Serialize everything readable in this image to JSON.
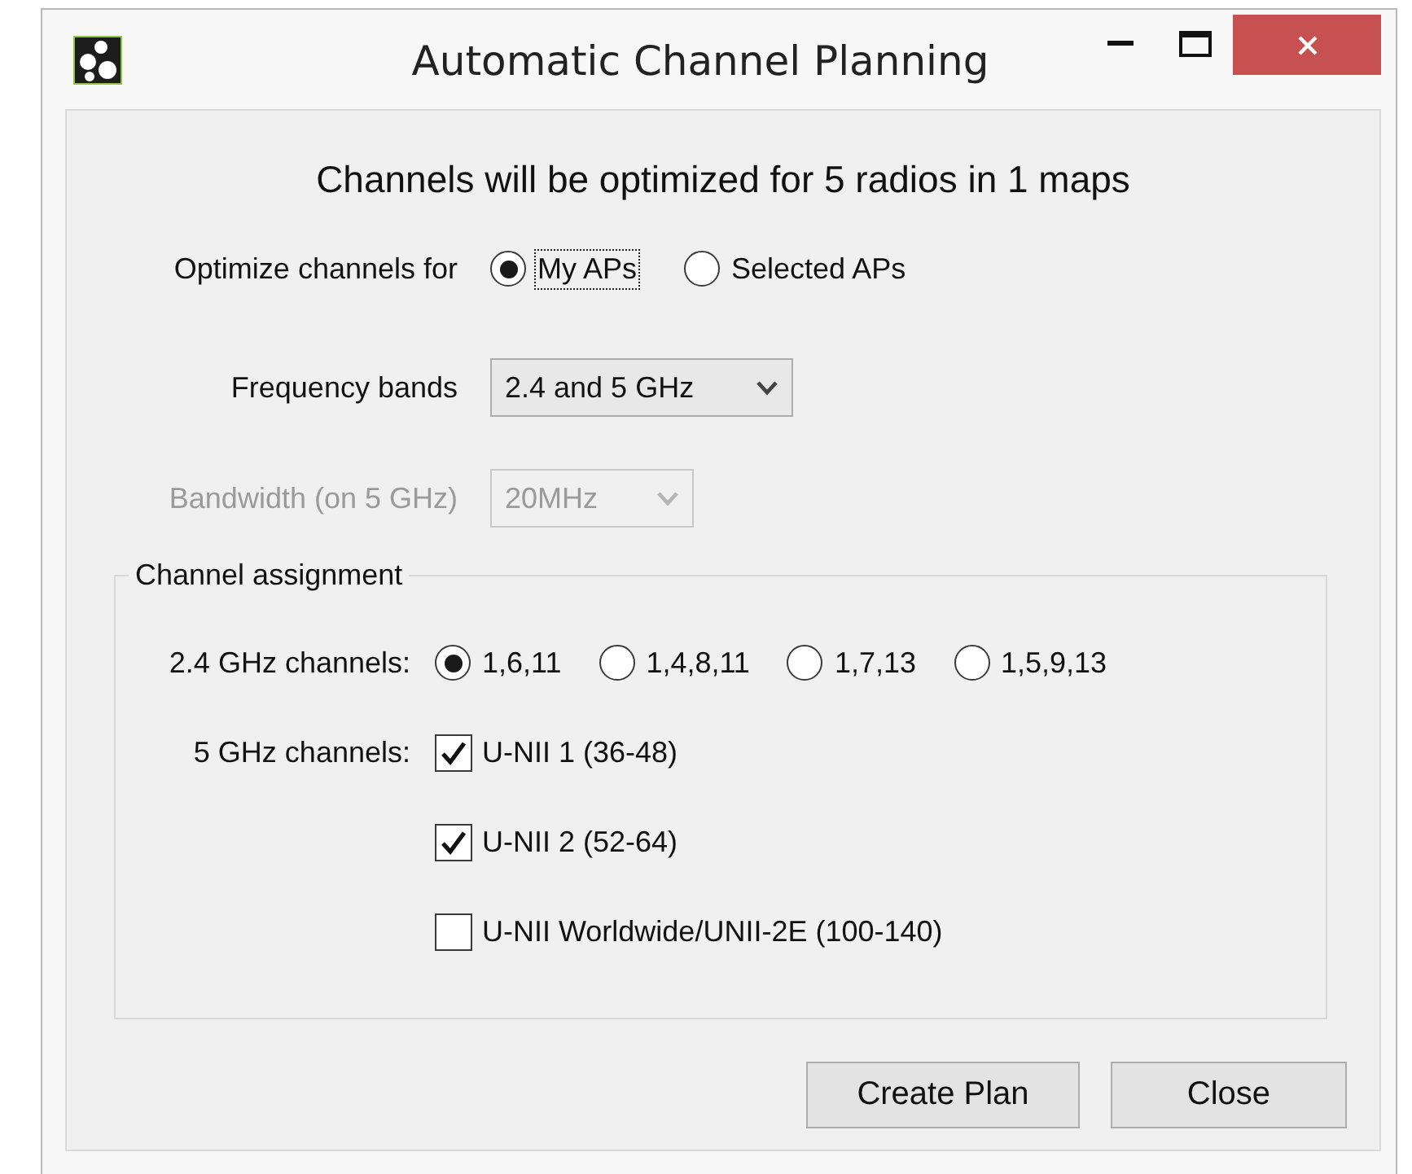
{
  "window": {
    "title": "Automatic Channel Planning"
  },
  "heading": "Channels will be optimized for 5 radios in 1 maps",
  "optimize_for": {
    "label": "Optimize channels for",
    "options": [
      {
        "label": "My APs",
        "selected": true,
        "focused": true
      },
      {
        "label": "Selected APs",
        "selected": false,
        "focused": false
      }
    ]
  },
  "frequency_bands": {
    "label": "Frequency bands",
    "value": "2.4 and 5 GHz",
    "disabled": false
  },
  "bandwidth": {
    "label": "Bandwidth (on 5 GHz)",
    "value": "20MHz",
    "disabled": true
  },
  "channel_assignment": {
    "title": "Channel assignment",
    "band_24": {
      "label": "2.4 GHz channels:",
      "options": [
        {
          "label": "1,6,11",
          "selected": true
        },
        {
          "label": "1,4,8,11",
          "selected": false
        },
        {
          "label": "1,7,13",
          "selected": false
        },
        {
          "label": "1,5,9,13",
          "selected": false
        }
      ]
    },
    "band_5": {
      "label": "5 GHz channels:",
      "options": [
        {
          "label": "U-NII 1 (36-48)",
          "checked": true
        },
        {
          "label": "U-NII 2 (52-64)",
          "checked": true
        },
        {
          "label": "U-NII Worldwide/UNII-2E (100-140)",
          "checked": false
        }
      ]
    }
  },
  "buttons": [
    {
      "label": "Create Plan"
    },
    {
      "label": "Close"
    }
  ]
}
